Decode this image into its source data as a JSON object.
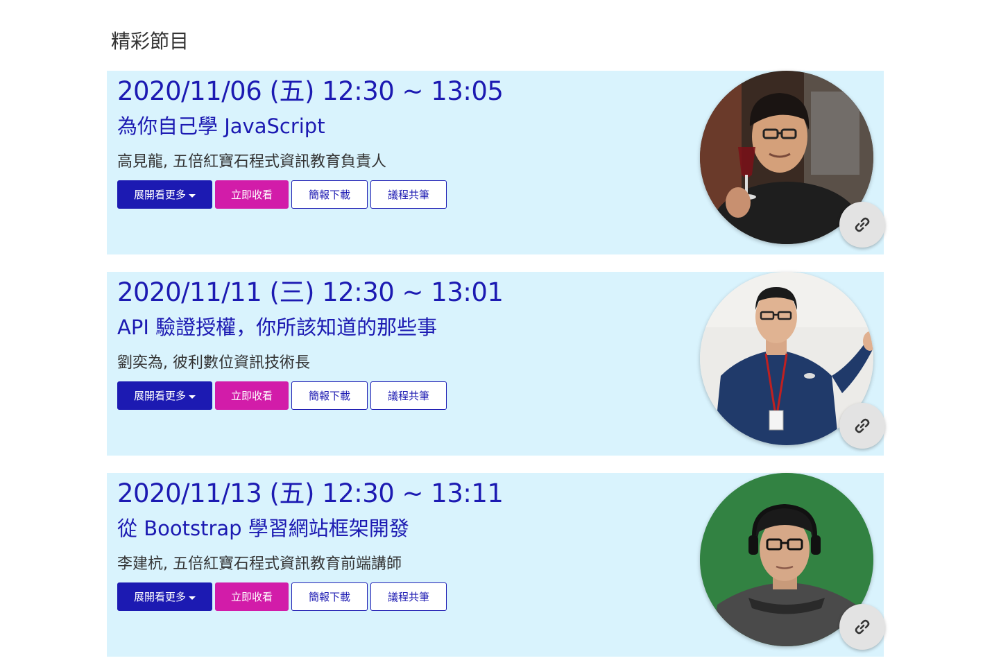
{
  "section": {
    "title": "精彩節目"
  },
  "sessions": [
    {
      "time": "2020/11/06 (五) 12:30 ~ 13:05",
      "title": "為你自己學 JavaScript",
      "speaker": "高見龍, 五倍紅寶石程式資訊教育負責人",
      "buttons": {
        "expand": "展開看更多",
        "watch": "立即收看",
        "slides": "簡報下載",
        "notes": "議程共筆"
      },
      "avatar_icon": "speaker-photo-1",
      "link_icon": "link-icon"
    },
    {
      "time": "2020/11/11 (三) 12:30 ~ 13:01",
      "title": "API 驗證授權，你所該知道的那些事",
      "speaker": "劉奕為, 彼利數位資訊技術長",
      "buttons": {
        "expand": "展開看更多",
        "watch": "立即收看",
        "slides": "簡報下載",
        "notes": "議程共筆"
      },
      "avatar_icon": "speaker-photo-2",
      "link_icon": "link-icon"
    },
    {
      "time": "2020/11/13 (五) 12:30 ~ 13:11",
      "title": "從 Bootstrap 學習網站框架開發",
      "speaker": "李建杭, 五倍紅寶石程式資訊教育前端講師",
      "buttons": {
        "expand": "展開看更多",
        "watch": "立即收看",
        "slides": "簡報下載",
        "notes": "議程共筆"
      },
      "avatar_icon": "speaker-photo-3",
      "link_icon": "link-icon"
    }
  ],
  "colors": {
    "card_bg": "#d9f3fd",
    "primary": "#1c1ab2",
    "accent": "#d21ca9"
  }
}
